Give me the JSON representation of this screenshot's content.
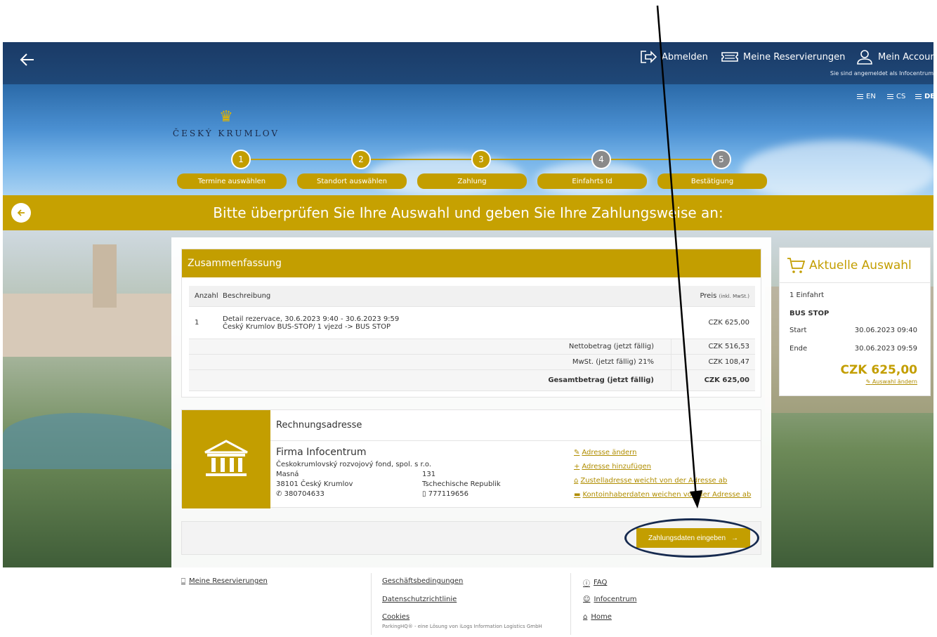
{
  "topbar": {
    "logout_label": "Abmelden",
    "reservations_label": "Meine Reservierungen",
    "account_label": "Mein Account",
    "logged_in_text": "Sie sind angemeldet als Infocentrum"
  },
  "languages": [
    "EN",
    "CS",
    "DE"
  ],
  "brand": {
    "name": "ČESKÝ KRUMLOV"
  },
  "steps": [
    {
      "number": "1",
      "label": "Termine auswählen",
      "active": true
    },
    {
      "number": "2",
      "label": "Standort auswählen",
      "active": true
    },
    {
      "number": "3",
      "label": "Zahlung",
      "active": true
    },
    {
      "number": "4",
      "label": "Einfahrts Id",
      "active": false
    },
    {
      "number": "5",
      "label": "Bestätigung",
      "active": false
    }
  ],
  "heading": "Bitte überprüfen Sie Ihre Auswahl und geben Sie Ihre Zahlungsweise an:",
  "summary": {
    "title": "Zusammenfassung",
    "col_qty": "Anzahl",
    "col_desc": "Beschreibung",
    "col_price": "Preis",
    "col_price_note": "(inkl. MwSt.)",
    "item": {
      "qty": "1",
      "line1": "Detail rezervace, 30.6.2023 9:40 - 30.6.2023 9:59",
      "line2": "Český Krumlov BUS-STOP/ 1 vjezd -> BUS STOP",
      "price": "CZK 625,00"
    },
    "net_label": "Nettobetrag (jetzt fällig)",
    "net_value": "CZK 516,53",
    "vat_label": "MwSt. (jetzt fällig) 21%",
    "vat_value": "CZK 108,47",
    "total_label": "Gesamtbetrag (jetzt fällig)",
    "total_value": "CZK 625,00"
  },
  "address": {
    "title": "Rechnungsadresse",
    "company": "Firma Infocentrum",
    "org": "Českokrumlovský rozvojový fond, spol. s r.o.",
    "street": "Masná",
    "house_no": "131",
    "city": "38101 Český Krumlov",
    "country": "Tschechische Republik",
    "phone": "380704633",
    "mobile": "777119656",
    "link_change": "Adresse ändern",
    "link_add": "Adresse hinzufügen",
    "link_delivery": "Zustelladresse weicht von der Adresse ab",
    "link_account": "Kontoinhaberdaten weichen von der Adresse ab"
  },
  "pay_button": "Zahlungsdaten eingeben",
  "side": {
    "title": "Aktuelle Auswahl",
    "count": "1 Einfahrt",
    "location": "BUS STOP",
    "start_label": "Start",
    "start_value": "30.06.2023 09:40",
    "end_label": "Ende",
    "end_value": "30.06.2023 09:59",
    "price": "CZK 625,00",
    "change": "Auswahl ändern"
  },
  "footer": {
    "reservations": "Meine Reservierungen",
    "terms": "Geschäftsbedingungen",
    "privacy": "Datenschutzrichtlinie",
    "cookies": "Cookies",
    "faq": "FAQ",
    "user": "Infocentrum",
    "home": "Home",
    "note": "ParkingHQ® - eine Lösung von iLogs Information Logistics GmbH"
  },
  "colors": {
    "accent": "#c39e00",
    "navy": "#1f4878",
    "ring": "#162a4f"
  }
}
